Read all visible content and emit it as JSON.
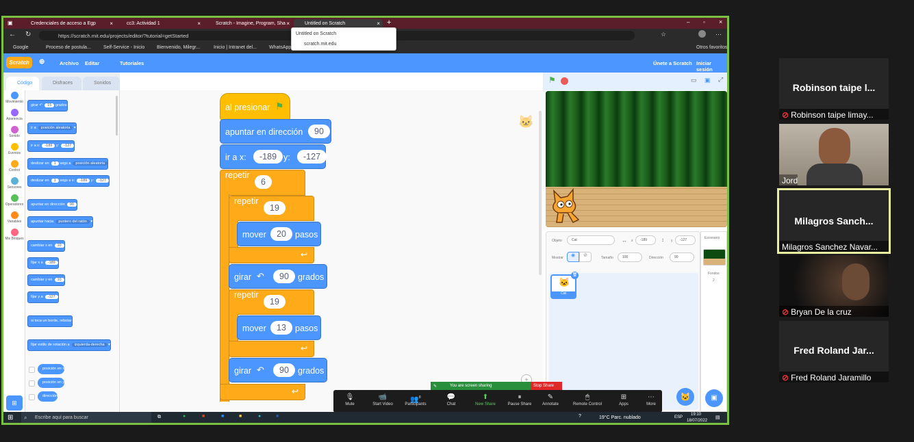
{
  "browser": {
    "tabs": [
      {
        "title": "Credenciales de acceso a Egp"
      },
      {
        "title": "cc3: Actividad 1"
      },
      {
        "title": "Scratch - Imagine, Program, Sha"
      },
      {
        "title": "Untitled on Scratch"
      }
    ],
    "url": "https://scratch.mit.edu/projects/editor/?tutorial=getStarted",
    "tooltip": {
      "title": "Untitled on Scratch",
      "host": "scratch.mit.edu"
    },
    "favorites": [
      "Google",
      "Proceso de postula...",
      "Self-Service - Inicio",
      "Bienvenido, Milegr...",
      "Inicio | Intranet del...",
      "WhatsApp",
      "Otros favoritos"
    ]
  },
  "scratch": {
    "menu": {
      "logo": "Scratch",
      "file": "Archivo",
      "edit": "Editar",
      "tutorials": "Tutoriales",
      "join": "Únete a Scratch",
      "signin": "Iniciar sesión"
    },
    "palette_tabs": [
      "Código",
      "Disfraces",
      "Sonidos"
    ],
    "categories": [
      {
        "label": "Movimiento",
        "color": "#4c97ff"
      },
      {
        "label": "Apariencia",
        "color": "#9966ff"
      },
      {
        "label": "Sonido",
        "color": "#cf63cf"
      },
      {
        "label": "Eventos",
        "color": "#ffbf00"
      },
      {
        "label": "Control",
        "color": "#ffab19"
      },
      {
        "label": "Sensores",
        "color": "#5cb1d6"
      },
      {
        "label": "Operadores",
        "color": "#59c059"
      },
      {
        "label": "Variables",
        "color": "#ff8c1a"
      },
      {
        "label": "Mis Bloques",
        "color": "#ff6680"
      }
    ],
    "palette_blocks": {
      "turn_ccw": "girar",
      "turn_ccw_val": "15",
      "turn_ccw_unit": "grados",
      "goto": "ir a",
      "goto_opt": "posición aleatoria",
      "gotoxy": "ir a x:",
      "gotoxy_x": "-189",
      "gotoxy_y_lbl": "y:",
      "gotoxy_y": "-127",
      "glide": "deslizar en",
      "glide_val": "1",
      "glide_mid": "segs a",
      "glide_opt": "posición aleatoria",
      "glidexy": "deslizar en",
      "glidexy_val": "1",
      "glidexy_mid": "segs a x:",
      "glidexy_x": "-189",
      "glidexy_y_lbl": "y:",
      "glidexy_y": "-127",
      "point": "apuntar en dirección",
      "point_val": "90",
      "pointto": "apuntar hacia",
      "pointto_opt": "puntero del ratón",
      "changex": "cambiar x en",
      "changex_val": "10",
      "setx": "fijar x a",
      "setx_val": "-189",
      "changey": "cambiar y en",
      "changey_val": "10",
      "sety": "fijar y a",
      "sety_val": "-127",
      "bounce": "si toca un borde, rebotar",
      "rotstyle": "fijar estilo de rotación a",
      "rotstyle_opt": "izquierda-derecha",
      "rep_x": "posición en x",
      "rep_y": "posición en y",
      "rep_dir": "dirección"
    },
    "script": {
      "hat": "al presionar",
      "point": "apuntar en dirección",
      "point_val": "90",
      "gotoxy": "ir a x:",
      "x_val": "-189",
      "y_lbl": "y:",
      "y_val": "-127",
      "repeat": "repetir",
      "repeat_val": "6",
      "repeat2": "repetir",
      "repeat2_val": "19",
      "move1": "mover",
      "move1_val": "20",
      "move1_unit": "pasos",
      "turn1": "girar",
      "turn1_val": "90",
      "turn1_unit": "grados",
      "repeat3": "repetir",
      "repeat3_val": "19",
      "move2": "mover",
      "move2_val": "13",
      "move2_unit": "pasos",
      "turn2": "girar",
      "turn2_val": "90",
      "turn2_unit": "grados"
    },
    "sprite_info": {
      "obj_lbl": "Objeto",
      "obj_val": "Cat",
      "x_lbl": "x",
      "x_val": "-189",
      "y_lbl": "y",
      "y_val": "-127",
      "show_lbl": "Mostrar",
      "size_lbl": "Tamaño",
      "size_val": "100",
      "dir_lbl": "Dirección",
      "dir_val": "90",
      "sprite_name": "Cat"
    },
    "stage_panel": {
      "title": "Escenario",
      "backdrops_lbl": "Fondos",
      "backdrops_val": "2"
    }
  },
  "zoom": {
    "sharing": "You are screen sharing",
    "stop_share": "Stop Share",
    "toolbar": [
      {
        "label": "Mute",
        "icon": "mic-icon"
      },
      {
        "label": "Start Video",
        "icon": "video-off-icon"
      },
      {
        "label": "Participants",
        "icon": "participants-icon",
        "count": "8"
      },
      {
        "label": "Chat",
        "icon": "chat-icon"
      },
      {
        "label": "New Share",
        "icon": "share-icon"
      },
      {
        "label": "Pause Share",
        "icon": "pause-icon"
      },
      {
        "label": "Annotate",
        "icon": "annotate-icon"
      },
      {
        "label": "Remote Control",
        "icon": "remote-icon"
      },
      {
        "label": "Apps",
        "icon": "apps-icon"
      },
      {
        "label": "More",
        "icon": "more-icon"
      }
    ],
    "participants": [
      {
        "big": "Robinson taipe l...",
        "name": "Robinson taipe limay..."
      },
      {
        "big": "",
        "name": "Jord"
      },
      {
        "big": "Milagros  Sanch...",
        "name": "Milagros Sanchez Navar..."
      },
      {
        "big": "",
        "name": "Bryan De la cruz"
      },
      {
        "big": "Fred Roland Jar...",
        "name": "Fred Roland Jaramillo"
      }
    ]
  },
  "taskbar": {
    "search": "Escribe aquí para buscar",
    "weather": "19°C  Parc. nublado",
    "lang": "ESP",
    "time": "19:10",
    "date": "18/07/2022"
  }
}
